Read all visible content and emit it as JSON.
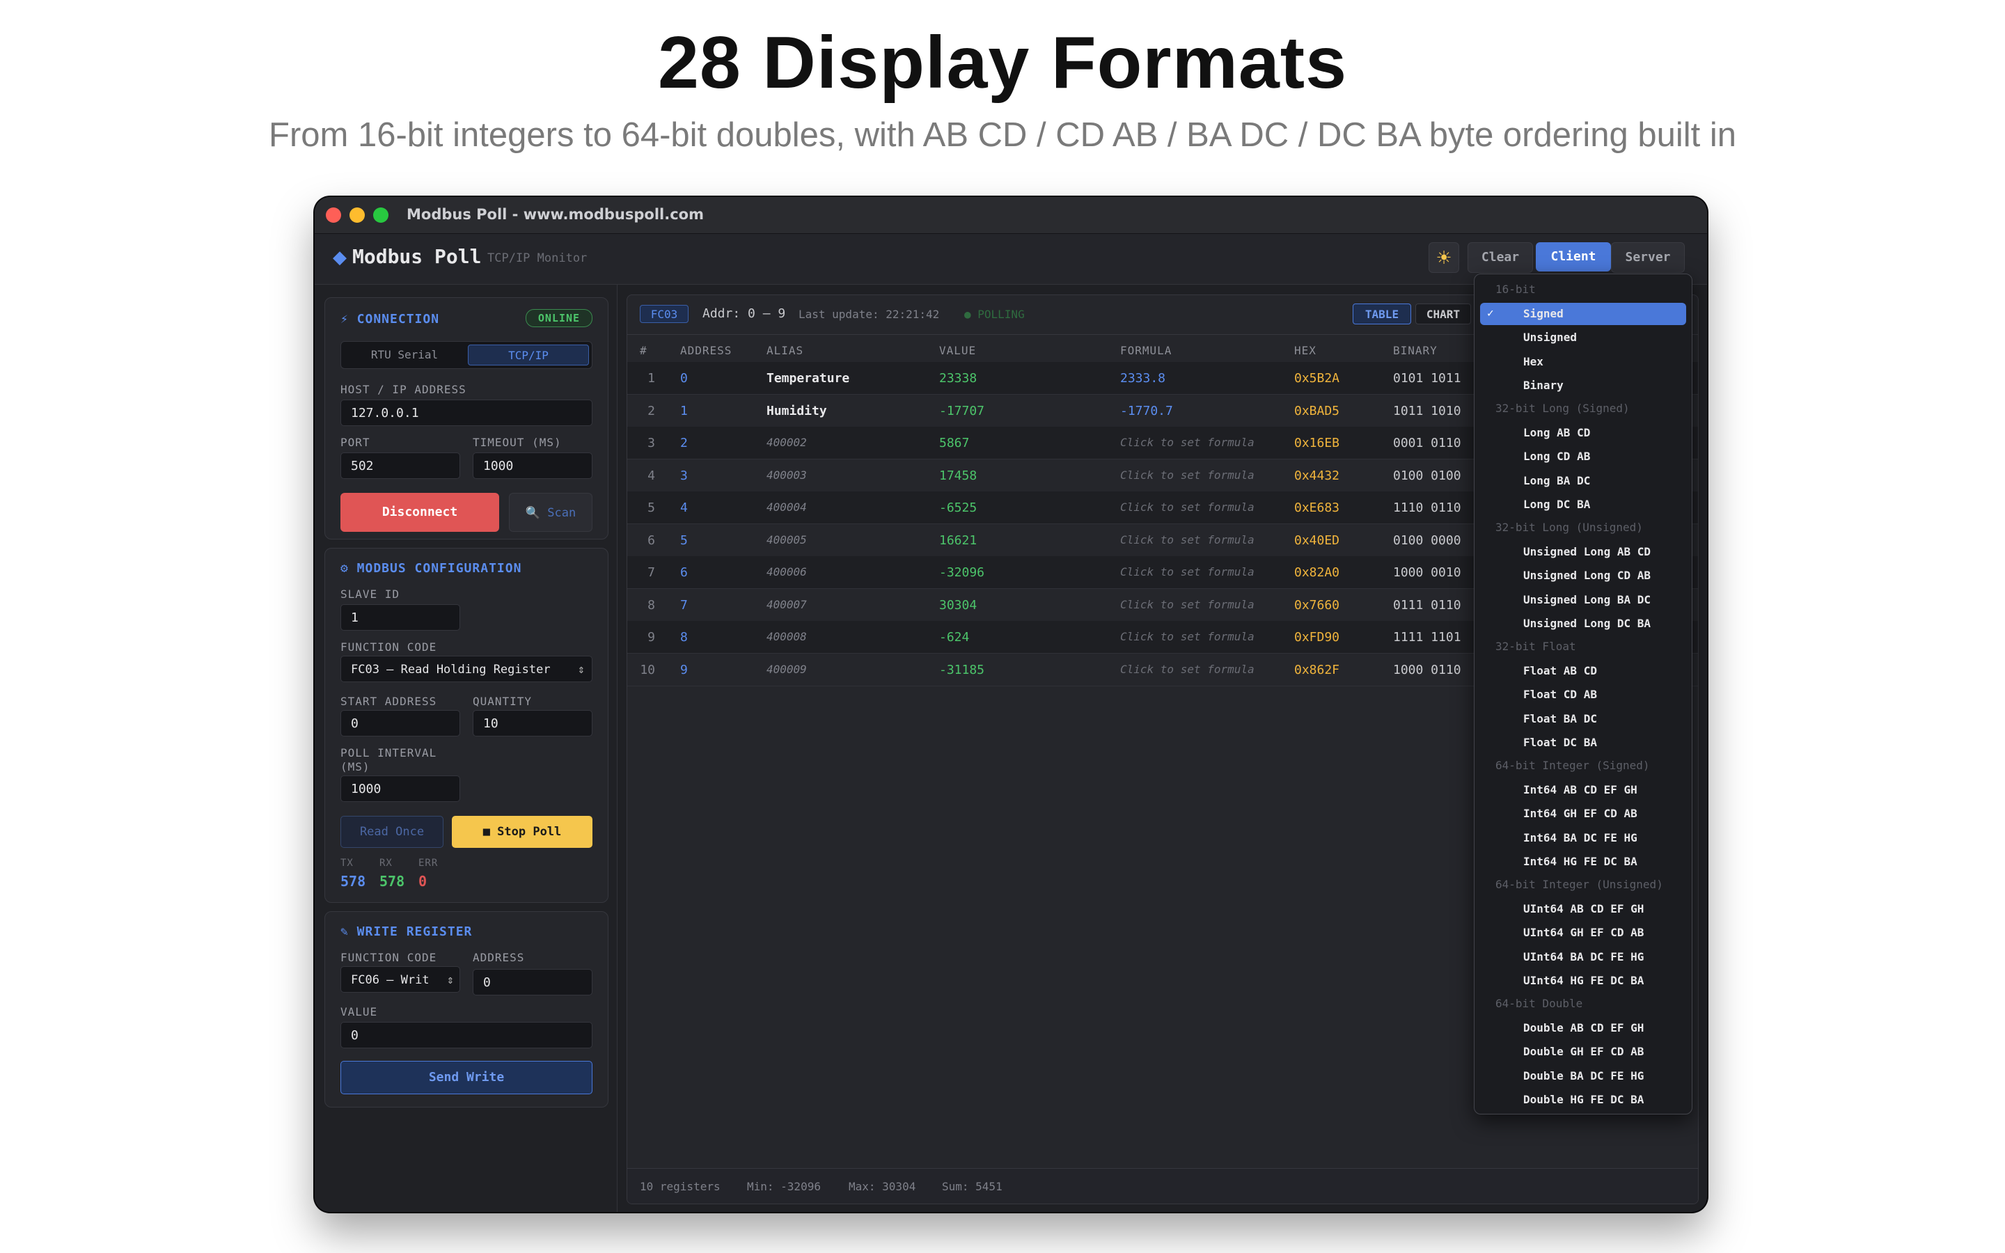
{
  "hero": {
    "title": "28 Display Formats",
    "subtitle": "From 16-bit integers to 64-bit doubles, with AB CD / CD AB / BA DC / DC BA byte ordering built in"
  },
  "window": {
    "title": "Modbus Poll - www.modbuspoll.com"
  },
  "appbar": {
    "brand": "Modbus Poll",
    "brand_sub": "TCP/IP Monitor",
    "theme_icon": "sun-icon",
    "clear_label": "Clear",
    "client_label": "Client",
    "server_label": "Server"
  },
  "connection": {
    "title": "⚡ CONNECTION",
    "status": "ONLINE",
    "tab_rtu": "RTU Serial",
    "tab_tcp": "TCP/IP",
    "host_label": "HOST / IP ADDRESS",
    "host_value": "127.0.0.1",
    "port_label": "PORT",
    "port_value": "502",
    "timeout_label": "TIMEOUT (MS)",
    "timeout_value": "1000",
    "disconnect_label": "Disconnect",
    "scan_label": "Scan"
  },
  "config": {
    "title": "⚙ MODBUS CONFIGURATION",
    "slave_label": "SLAVE ID",
    "slave_value": "1",
    "fc_label": "FUNCTION CODE",
    "fc_value": "FC03 — Read Holding Register",
    "start_label": "START ADDRESS",
    "start_value": "0",
    "qty_label": "QUANTITY",
    "qty_value": "10",
    "poll_label_1": "POLL INTERVAL",
    "poll_label_2": "(MS)",
    "poll_value": "1000",
    "read_once_label": "Read Once",
    "stop_poll_label": "■ Stop Poll",
    "tx_label": "TX",
    "rx_label": "RX",
    "err_label": "ERR",
    "tx_value": "578",
    "rx_value": "578",
    "err_value": "0"
  },
  "write": {
    "title": "✎ WRITE REGISTER",
    "fc_label": "FUNCTION CODE",
    "fc_value": "FC06 — Writ",
    "addr_label": "ADDRESS",
    "addr_value": "0",
    "value_label": "VALUE",
    "value_value": "0",
    "send_label": "Send Write"
  },
  "toolbar": {
    "fc_badge": "FC03",
    "addr_range": "Addr: 0 — 9",
    "last_update": "Last update: 22:21:42",
    "polling": "● POLLING",
    "table_label": "TABLE",
    "chart_label": "CHART"
  },
  "table": {
    "headers": [
      "#",
      "ADDRESS",
      "ALIAS",
      "VALUE",
      "FORMULA",
      "HEX",
      "BINARY"
    ],
    "rows": [
      {
        "n": "1",
        "addr": "0",
        "alias": "Temperature",
        "value": "23338",
        "formula": "2333.8",
        "hex": "0x5B2A",
        "bin": "0101 1011"
      },
      {
        "n": "2",
        "addr": "1",
        "alias": "Humidity",
        "value": "-17707",
        "formula": "-1770.7",
        "hex": "0xBAD5",
        "bin": "1011 1010"
      },
      {
        "n": "3",
        "addr": "2",
        "alias": "400002",
        "value": "5867",
        "formula": "Click to set formula",
        "hex": "0x16EB",
        "bin": "0001 0110"
      },
      {
        "n": "4",
        "addr": "3",
        "alias": "400003",
        "value": "17458",
        "formula": "Click to set formula",
        "hex": "0x4432",
        "bin": "0100 0100"
      },
      {
        "n": "5",
        "addr": "4",
        "alias": "400004",
        "value": "-6525",
        "formula": "Click to set formula",
        "hex": "0xE683",
        "bin": "1110 0110"
      },
      {
        "n": "6",
        "addr": "5",
        "alias": "400005",
        "value": "16621",
        "formula": "Click to set formula",
        "hex": "0x40ED",
        "bin": "0100 0000"
      },
      {
        "n": "7",
        "addr": "6",
        "alias": "400006",
        "value": "-32096",
        "formula": "Click to set formula",
        "hex": "0x82A0",
        "bin": "1000 0010"
      },
      {
        "n": "8",
        "addr": "7",
        "alias": "400007",
        "value": "30304",
        "formula": "Click to set formula",
        "hex": "0x7660",
        "bin": "0111 0110"
      },
      {
        "n": "9",
        "addr": "8",
        "alias": "400008",
        "value": "-624",
        "formula": "Click to set formula",
        "hex": "0xFD90",
        "bin": "1111 1101"
      },
      {
        "n": "10",
        "addr": "9",
        "alias": "400009",
        "value": "-31185",
        "formula": "Click to set formula",
        "hex": "0x862F",
        "bin": "1000 0110"
      }
    ]
  },
  "footer": {
    "registers": "10 registers",
    "min": "Min: -32096",
    "max": "Max: 30304",
    "sum": "Sum: 5451"
  },
  "dropdown": {
    "groups": [
      {
        "header": "16-bit",
        "items": [
          "Signed",
          "Unsigned",
          "Hex",
          "Binary"
        ]
      },
      {
        "header": "32-bit Long (Signed)",
        "items": [
          "Long AB CD",
          "Long CD AB",
          "Long BA DC",
          "Long DC BA"
        ]
      },
      {
        "header": "32-bit Long (Unsigned)",
        "items": [
          "Unsigned Long AB CD",
          "Unsigned Long CD AB",
          "Unsigned Long BA DC",
          "Unsigned Long DC BA"
        ]
      },
      {
        "header": "32-bit Float",
        "items": [
          "Float AB CD",
          "Float CD AB",
          "Float BA DC",
          "Float DC BA"
        ]
      },
      {
        "header": "64-bit Integer (Signed)",
        "items": [
          "Int64 AB CD EF GH",
          "Int64 GH EF CD AB",
          "Int64 BA DC FE HG",
          "Int64 HG FE DC BA"
        ]
      },
      {
        "header": "64-bit Integer (Unsigned)",
        "items": [
          "UInt64 AB CD EF GH",
          "UInt64 GH EF CD AB",
          "UInt64 BA DC FE HG",
          "UInt64 HG FE DC BA"
        ]
      },
      {
        "header": "64-bit Double",
        "items": [
          "Double AB CD EF GH",
          "Double GH EF CD AB",
          "Double BA DC FE HG",
          "Double HG FE DC BA"
        ]
      }
    ],
    "selected": "Signed",
    "check": "✓"
  },
  "colors": {
    "accent": "#5b8def",
    "value_green": "#4cc46a",
    "hex_orange": "#f0b43c",
    "danger": "#e05555",
    "warning": "#f5c64d"
  }
}
